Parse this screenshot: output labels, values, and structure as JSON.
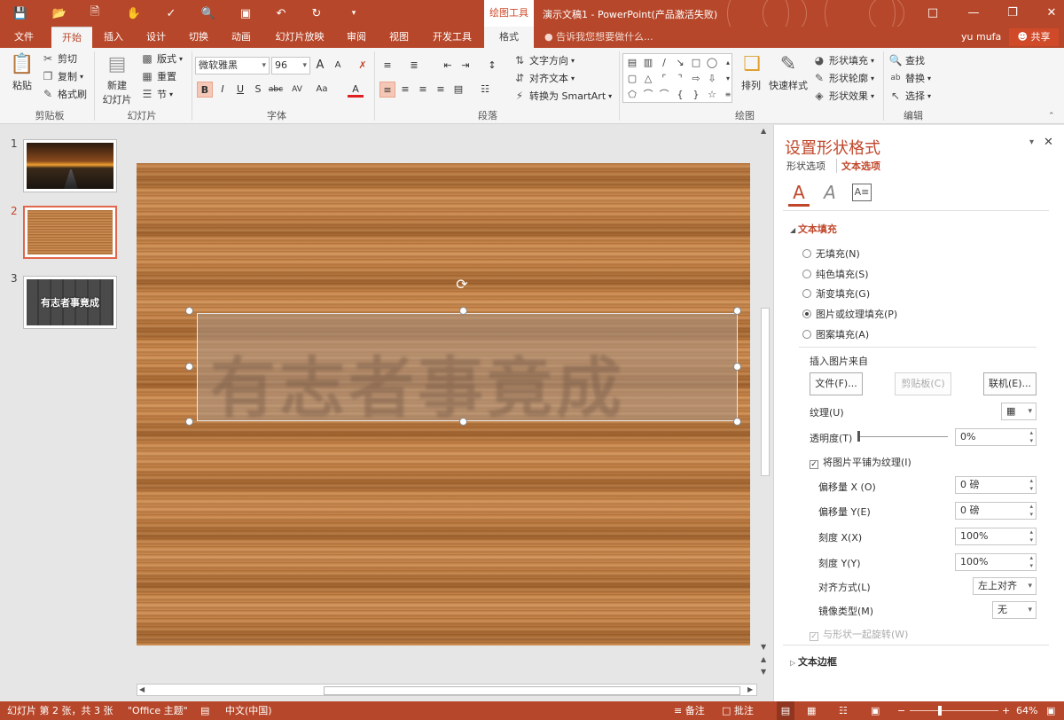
{
  "titlebar": {
    "context_tab": "绘图工具",
    "doc_title": "演示文稿1 - PowerPoint(产品激活失败)",
    "help_icon": "?",
    "minimize": "—",
    "restore": "❐",
    "close": "✕"
  },
  "tabs": {
    "file": "文件",
    "home": "开始",
    "insert": "插入",
    "design": "设计",
    "transitions": "切换",
    "animations": "动画",
    "slideshow": "幻灯片放映",
    "review": "审阅",
    "view": "视图",
    "developer": "开发工具",
    "format": "格式",
    "tellme": "告诉我您想要做什么...",
    "user": "yu mufa",
    "share": "共享"
  },
  "ribbon": {
    "clipboard": {
      "paste": "粘贴",
      "cut": "剪切",
      "copy": "复制",
      "painter": "格式刷",
      "label": "剪贴板"
    },
    "slides": {
      "new_slide": "新建",
      "new_slide2": "幻灯片",
      "layout": "版式",
      "reset": "重置",
      "section": "节",
      "label": "幻灯片"
    },
    "font": {
      "name": "微软雅黑",
      "size": "96",
      "label": "字体"
    },
    "paragraph": {
      "text_dir": "文字方向",
      "align_text": "对齐文本",
      "smartart": "转换为 SmartArt",
      "label": "段落"
    },
    "drawing": {
      "arrange": "排列",
      "quick_styles": "快速样式",
      "shape_fill": "形状填充",
      "shape_outline": "形状轮廓",
      "shape_effects": "形状效果",
      "label": "绘图"
    },
    "editing": {
      "find": "查找",
      "replace": "替换",
      "select": "选择",
      "label": "编辑"
    }
  },
  "thumbnails": [
    {
      "num": "1",
      "text": ""
    },
    {
      "num": "2",
      "text": ""
    },
    {
      "num": "3",
      "text": "有志者事竟成"
    }
  ],
  "pane": {
    "title": "设置形状格式",
    "tab_shape": "形状选项",
    "tab_text": "文本选项",
    "section_fill": "文本填充",
    "fill_options": [
      "无填充(N)",
      "纯色填充(S)",
      "渐变填充(G)",
      "图片或纹理填充(P)",
      "图案填充(A)"
    ],
    "insert_from": "插入图片来自",
    "btn_file": "文件(F)...",
    "btn_clipboard": "剪贴板(C)",
    "btn_online": "联机(E)...",
    "texture": "纹理(U)",
    "transparency": "透明度(T)",
    "transparency_value": "0%",
    "tile": "将图片平铺为纹理(I)",
    "offset_x": "偏移量 X (O)",
    "offset_x_value": "0 磅",
    "offset_y": "偏移量 Y(E)",
    "offset_y_value": "0 磅",
    "scale_x": "刻度 X(X)",
    "scale_x_value": "100%",
    "scale_y": "刻度 Y(Y)",
    "scale_y_value": "100%",
    "alignment": "对齐方式(L)",
    "alignment_value": "左上对齐",
    "mirror": "镜像类型(M)",
    "mirror_value": "无",
    "rotate_with": "与形状一起旋转(W)",
    "section_border": "文本边框"
  },
  "status": {
    "slide_info": "幻灯片 第 2 张，共 3 张",
    "theme": "\"Office 主题\"",
    "language": "中文(中国)",
    "notes": "备注",
    "comments": "批注",
    "zoom": "64%"
  },
  "colors": {
    "accent": "#b7472a",
    "pane_title": "#c0472b"
  }
}
